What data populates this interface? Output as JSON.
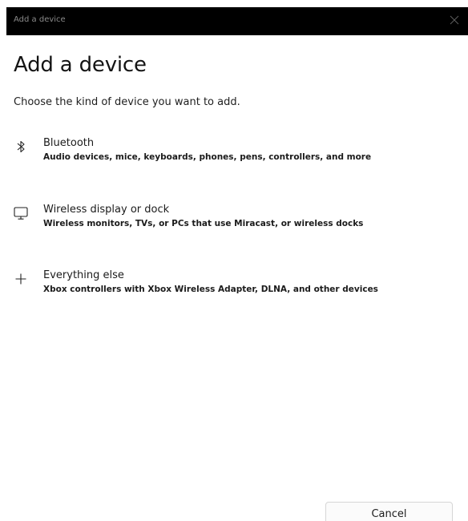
{
  "window": {
    "title": "Add a device",
    "close_icon": "close-icon"
  },
  "main": {
    "heading": "Add a device",
    "subtitle": "Choose the kind of device you want to add.",
    "options": [
      {
        "icon": "bluetooth-icon",
        "label": "Bluetooth",
        "description": "Audio devices, mice, keyboards, phones, pens, controllers, and more"
      },
      {
        "icon": "monitor-icon",
        "label": "Wireless display or dock",
        "description": "Wireless monitors, TVs, or PCs that use Miracast, or wireless docks"
      },
      {
        "icon": "plus-icon",
        "label": "Everything else",
        "description": "Xbox controllers with Xbox Wireless Adapter, DLNA, and other devices"
      }
    ]
  },
  "footer": {
    "cancel_label": "Cancel"
  },
  "colors": {
    "titlebar_bg": "#000000",
    "background": "#ffffff",
    "text": "#1b1b1b"
  }
}
